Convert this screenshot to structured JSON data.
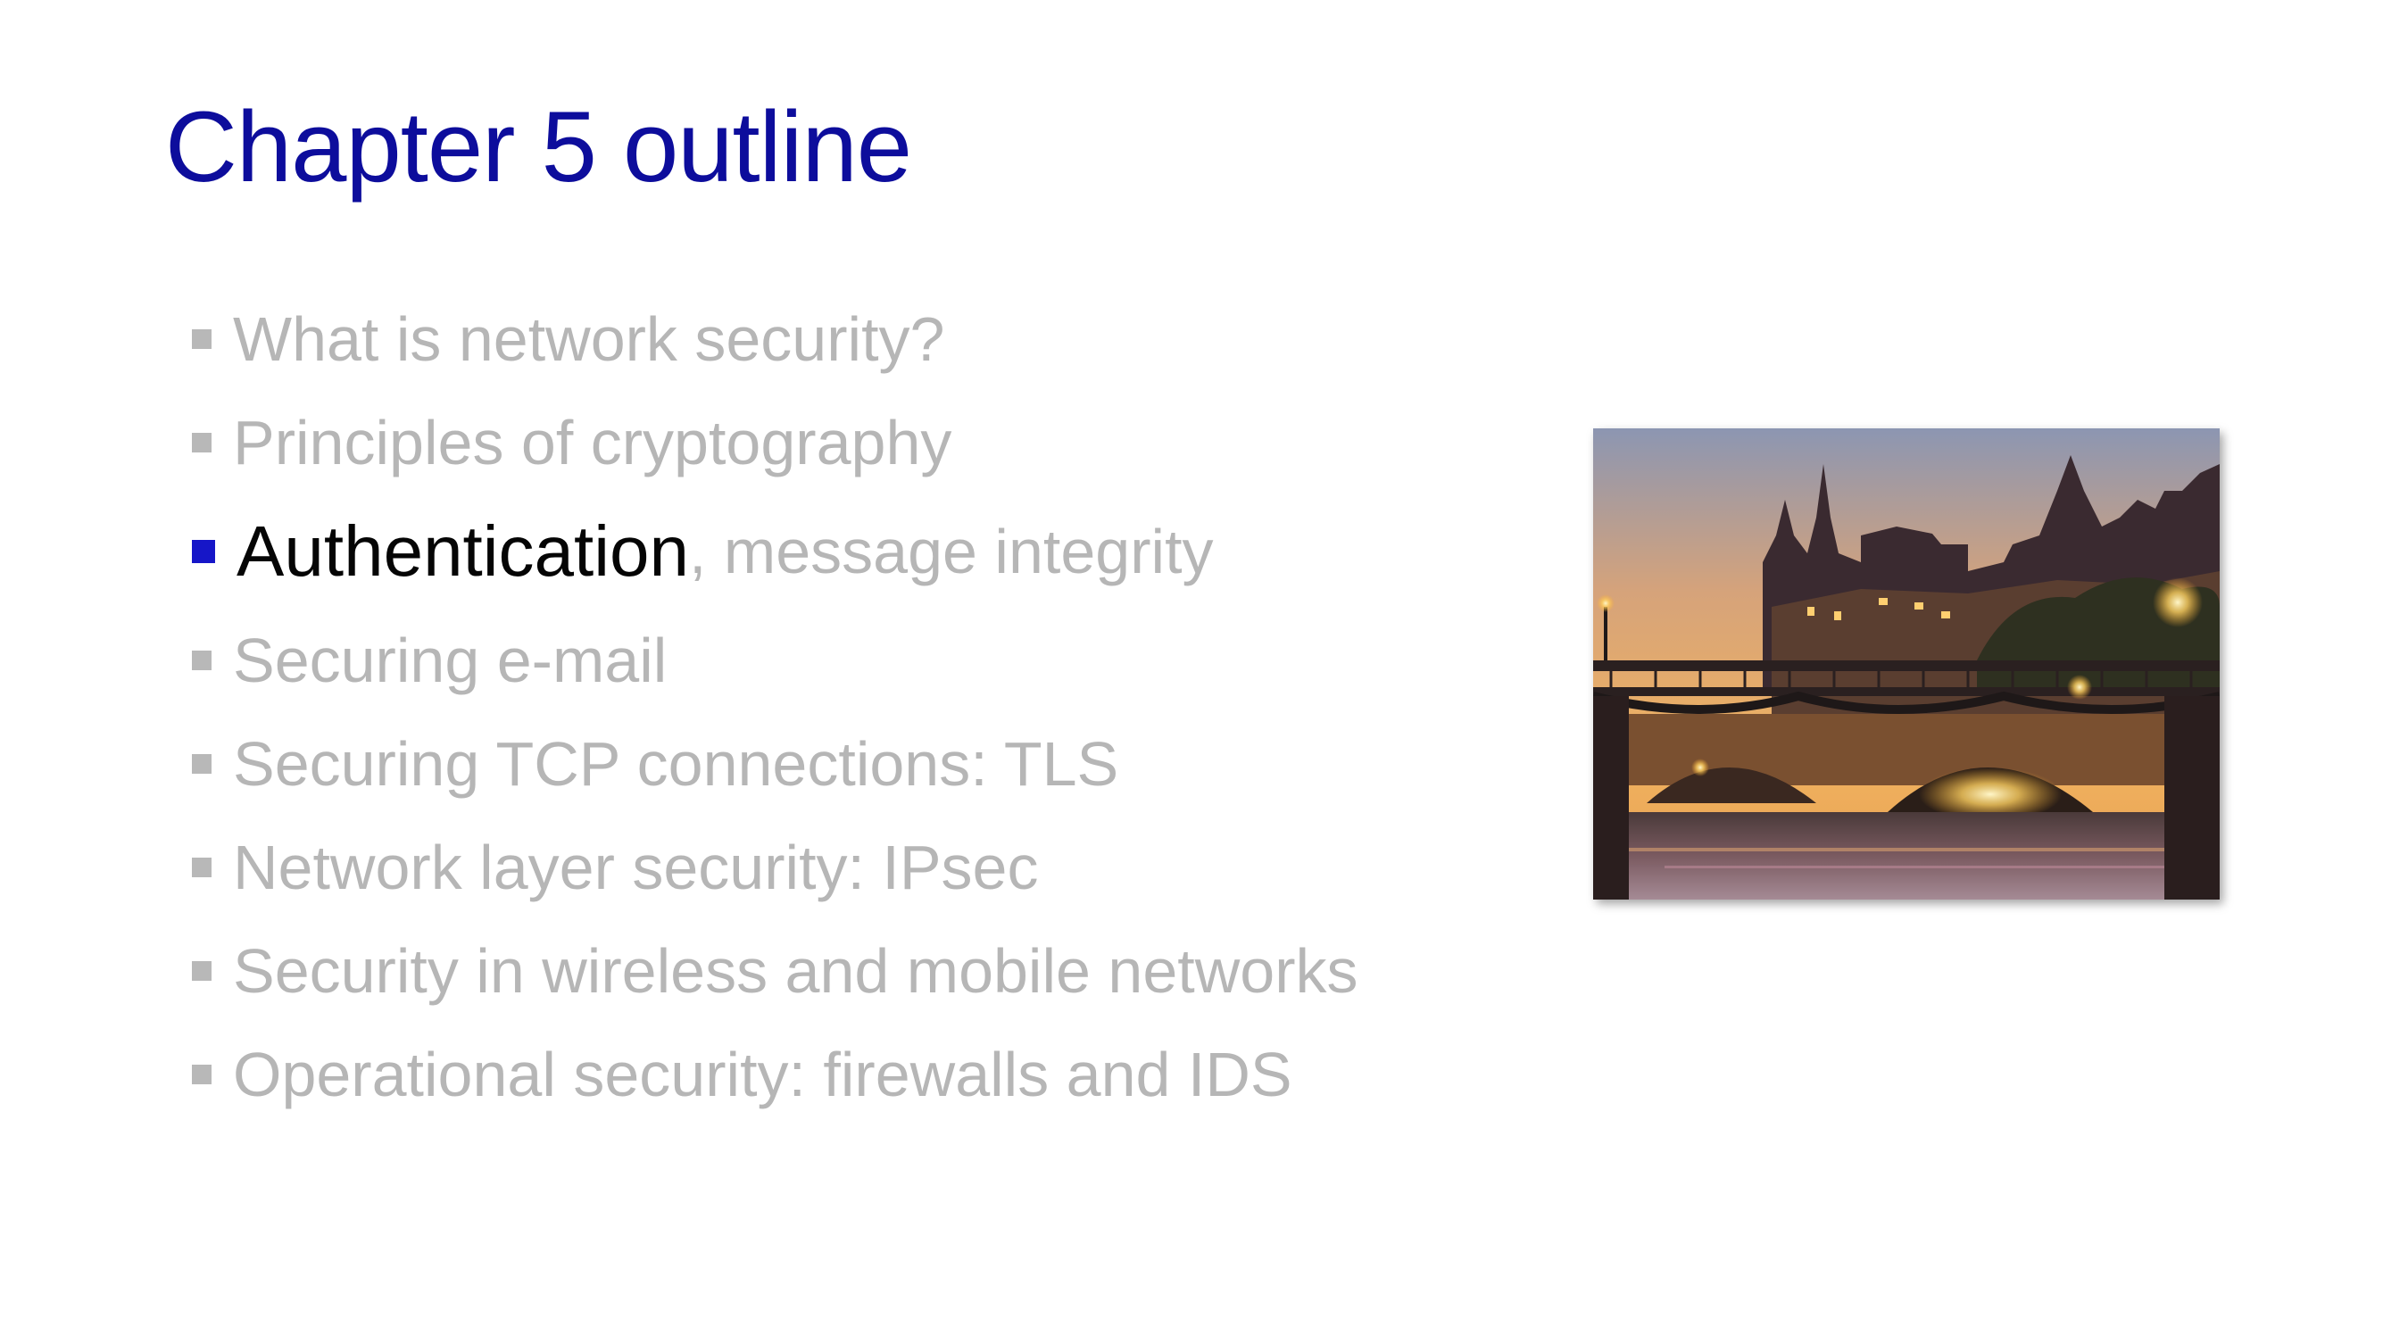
{
  "slide": {
    "title": "Chapter 5 outline",
    "items": [
      {
        "text": "What is network security?"
      },
      {
        "text": "Principles of cryptography"
      },
      {
        "strong": "Authentication",
        "rest": ", message integrity"
      },
      {
        "text": "Securing e-mail"
      },
      {
        "text": "Securing TCP connections: TLS"
      },
      {
        "text": "Network layer security: IPsec"
      },
      {
        "text": "Security in wireless and mobile networks"
      },
      {
        "text": "Operational security: firewalls and IDS"
      }
    ]
  },
  "colors": {
    "title": "#0d0d9c",
    "active_bullet": "#1616c8",
    "inactive_text": "#b6b6b6",
    "active_text": "#050505"
  }
}
